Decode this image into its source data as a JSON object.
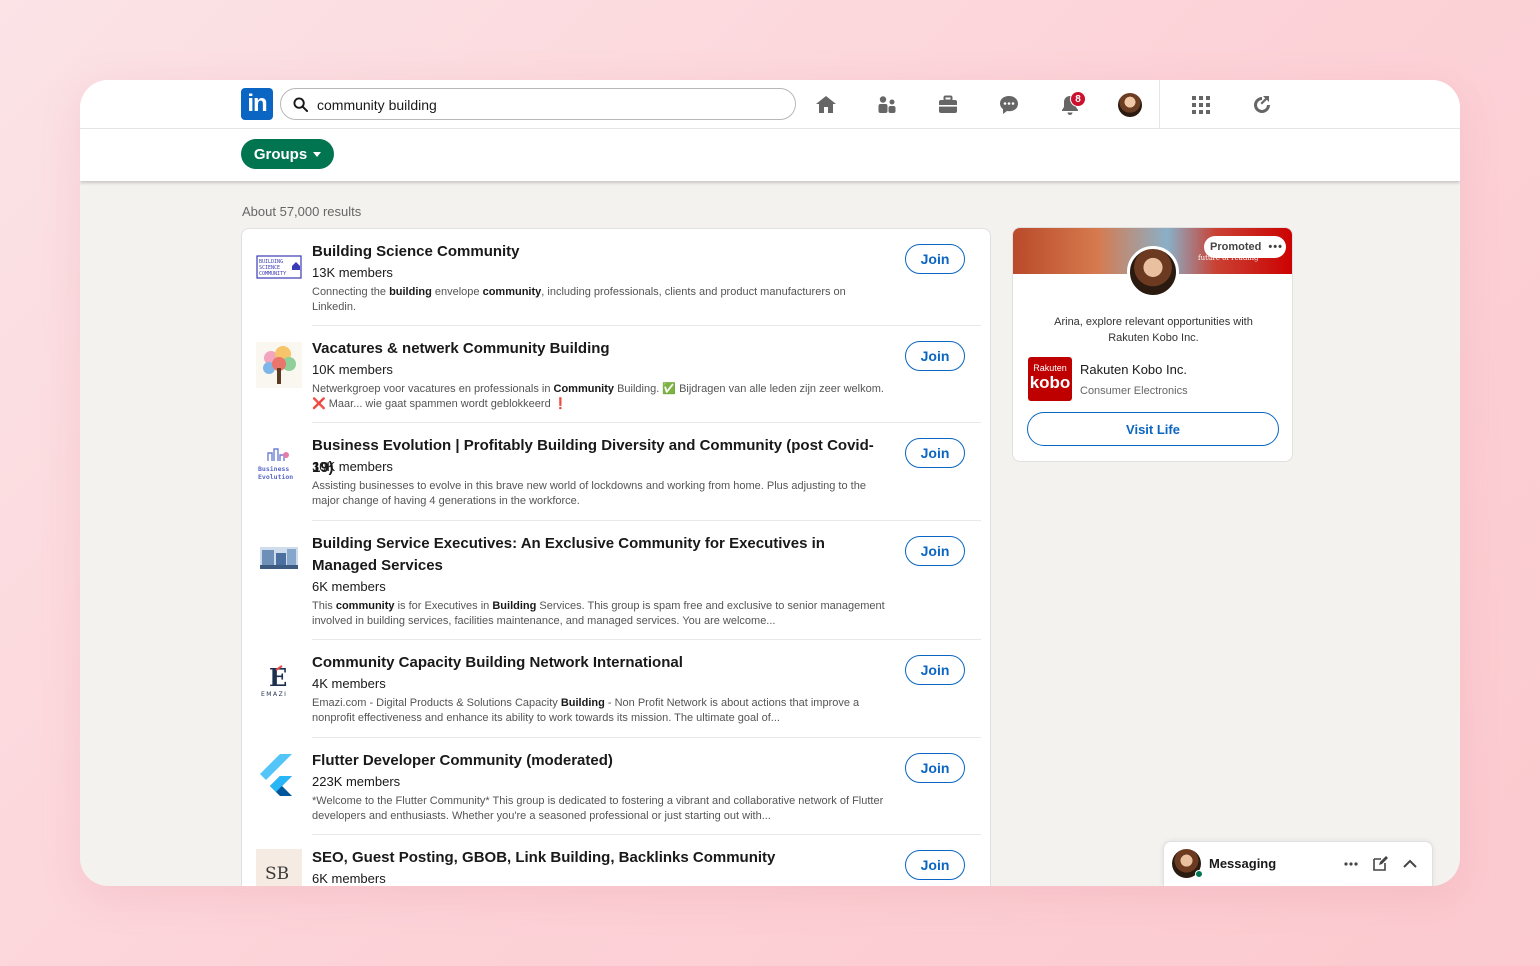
{
  "topbar": {
    "logo_text": "in",
    "search_value": "community building",
    "nav_icons": [
      "home-icon",
      "my-network-icon",
      "jobs-icon",
      "messaging-icon",
      "notifications-icon",
      "me-avatar",
      "work-grid-icon",
      "advertise-icon"
    ],
    "notification_count": "8"
  },
  "filters": {
    "groups_label": "Groups"
  },
  "results": {
    "count_text": "About 57,000 results",
    "join_label": "Join",
    "items": [
      {
        "title": "Building Science Community",
        "members": "13K members",
        "desc_html": "Connecting the <b>building</b> envelope <b>community</b>, including professionals, clients and product manufacturers on Linkedin."
      },
      {
        "title": "Vacatures & netwerk Community Building",
        "members": "10K members",
        "desc_html": "Netwerkgroep voor vacatures en professionals in <b>Community</b> Building. ✅ Bijdragen van alle leden zijn zeer welkom. ❌ Maar... wie gaat spammen wordt geblokkeerd ❗"
      },
      {
        "title": "Business Evolution | Profitably Building Diversity and Community (post Covid-19)",
        "members": "30K members",
        "desc_html": "Assisting businesses to evolve in this brave new world of lockdowns and working from home. Plus adjusting to the major change of having 4 generations in the workforce."
      },
      {
        "title": "Building Service Executives: An Exclusive Community for Executives in Managed Services",
        "members": "6K members",
        "desc_html": "This <b>community</b> is for Executives in <b>Building</b> Services. This group is spam free and exclusive to senior management involved in building services, facilities maintenance, and managed services. You are welcome..."
      },
      {
        "title": "Community Capacity Building Network International",
        "members": "4K members",
        "desc_html": "Emazi.com - Digital Products & Solutions Capacity <b>Building</b> - Non Profit Network is about actions that improve a nonprofit effectiveness and enhance its ability to work towards its mission. The ultimate goal of..."
      },
      {
        "title": "Flutter Developer Community (moderated)",
        "members": "223K members",
        "desc_html": "*Welcome to the Flutter Community* This group is dedicated to fostering a vibrant and collaborative network of Flutter developers and enthusiasts. Whether you're a seasoned professional or just starting out with..."
      },
      {
        "title": "SEO, Guest Posting, GBOB, Link Building, Backlinks Community",
        "members": "6K members",
        "desc_html": ""
      }
    ]
  },
  "ad": {
    "promoted_label": "Promoted",
    "banner_text": "future of reading",
    "text": "Arina, explore relevant opportunities with Rakuten Kobo Inc.",
    "logo_line1": "Rakuten",
    "logo_line2": "kobo",
    "company": "Rakuten Kobo Inc.",
    "industry": "Consumer Electronics",
    "cta": "Visit Life"
  },
  "messaging": {
    "label": "Messaging"
  },
  "thumbs": {
    "t1": "BUILDING SCIENCE COMMUNITY",
    "t3a": "Business",
    "t3b": "Evolution",
    "t5a": "E",
    "t5b": "EMAZI",
    "t7": "SB"
  },
  "colors": {
    "brand_blue": "#0a66c2",
    "groups_green": "#01754f",
    "badge_red": "#cb112d",
    "kobo_red": "#bf0000"
  }
}
